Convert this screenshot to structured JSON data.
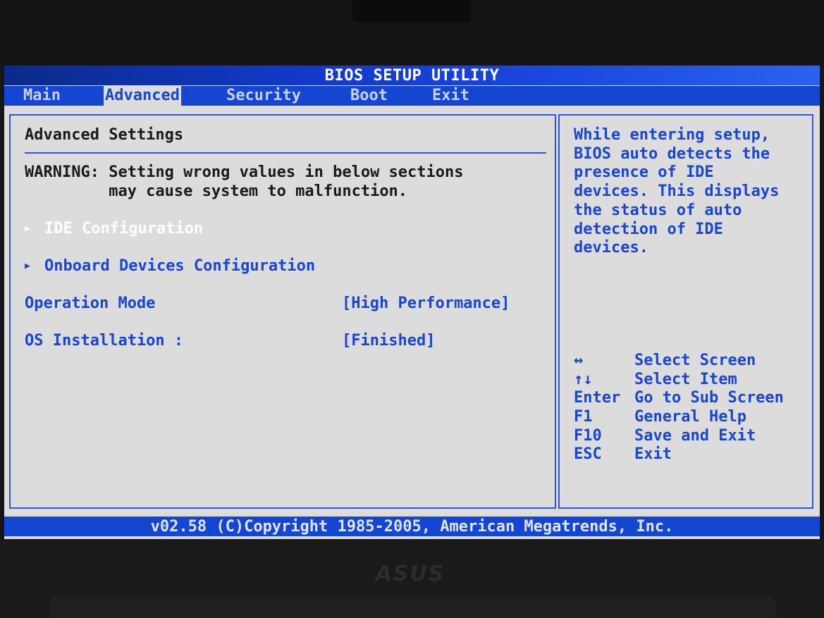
{
  "title": "BIOS SETUP UTILITY",
  "menu": {
    "tabs": [
      {
        "label": "Main"
      },
      {
        "label": "Advanced",
        "active": true
      },
      {
        "label": "Security"
      },
      {
        "label": "Boot"
      },
      {
        "label": "Exit"
      }
    ]
  },
  "main": {
    "section_title": "Advanced Settings",
    "warning": {
      "line1": "WARNING: Setting wrong values in below sections",
      "line2": "         may cause system to malfunction."
    },
    "submenus": [
      {
        "label": "IDE Configuration",
        "selected": true
      },
      {
        "label": "Onboard Devices Configuration"
      }
    ],
    "settings": [
      {
        "label": "Operation Mode",
        "value": "[High Performance]"
      },
      {
        "label": "OS Installation :",
        "value": "[Finished]"
      }
    ]
  },
  "help": {
    "lines": [
      "While entering setup,",
      "BIOS auto detects the",
      "presence of IDE",
      "devices. This displays",
      "the status of auto",
      "detection of IDE",
      "devices."
    ],
    "keys": [
      {
        "key": "↔",
        "action": "Select Screen"
      },
      {
        "key": "↑↓",
        "action": "Select Item"
      },
      {
        "key": "Enter",
        "action": "Go to Sub Screen"
      },
      {
        "key": "F1",
        "action": "General Help"
      },
      {
        "key": "F10",
        "action": "Save and Exit"
      },
      {
        "key": "ESC",
        "action": "Exit"
      }
    ]
  },
  "footer": "v02.58 (C)Copyright 1985-2005, American Megatrends, Inc.",
  "bezel": {
    "brand": "ASUS"
  },
  "colors": {
    "screen_bg": "#dcdcdc",
    "accent_blue": "#1546d2",
    "text_blue": "#1846d2",
    "highlight": "#ffffff"
  }
}
